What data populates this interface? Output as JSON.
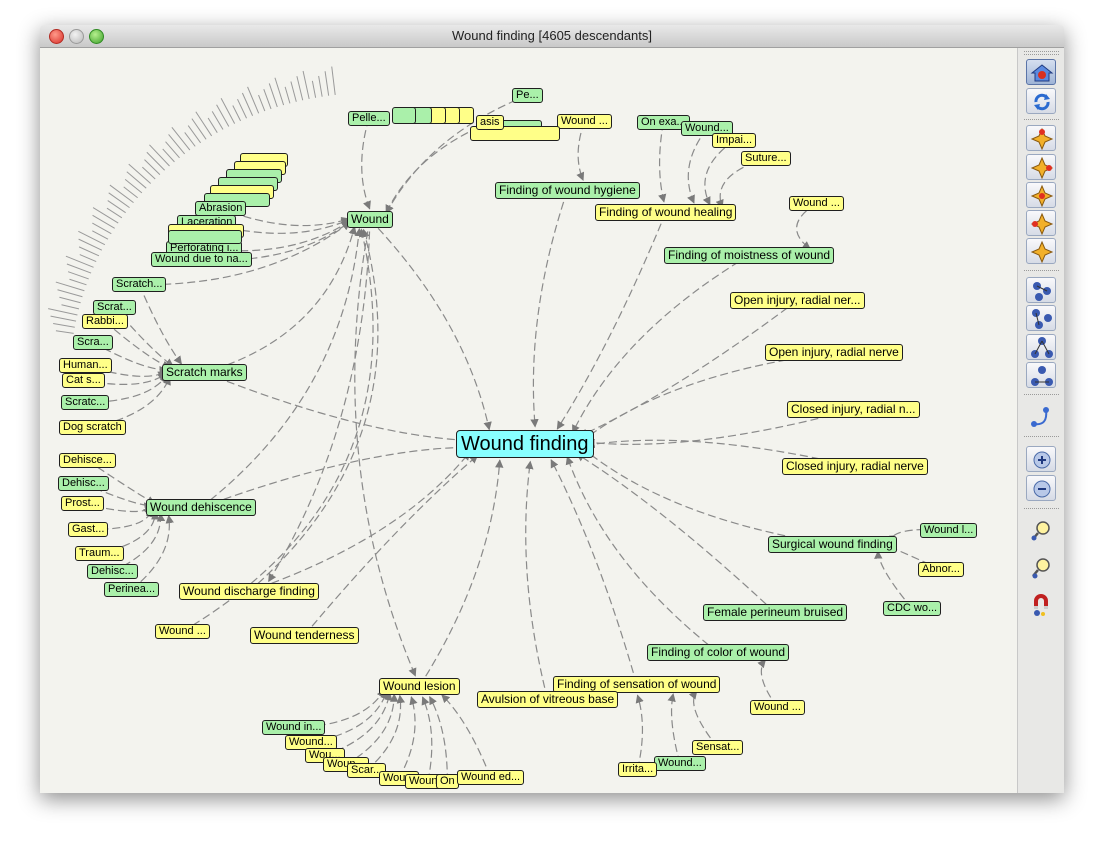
{
  "window": {
    "title": "Wound finding [4605 descendants]"
  },
  "graph": {
    "root": "Wound finding",
    "nodes": {
      "wound": "Wound",
      "wound_hygiene": "Finding of wound hygiene",
      "wound_healing": "Finding of wound healing",
      "moistness": "Finding of moistness of wound",
      "open_radial_trunc": "Open injury, radial ner...",
      "open_radial": "Open injury, radial nerve",
      "closed_radial_trunc": "Closed injury, radial n...",
      "closed_radial": "Closed injury, radial nerve",
      "surgical": "Surgical wound finding",
      "perineum": "Female perineum bruised",
      "color": "Finding of color of wound",
      "sensation": "Finding of sensation of wound",
      "avulsion": "Avulsion of vitreous base",
      "lesion": "Wound lesion",
      "tenderness": "Wound tenderness",
      "discharge": "Wound discharge finding",
      "dehiscence": "Wound dehiscence",
      "scratch": "Scratch marks",
      "wound_top": "Wound ...",
      "on_exa": "On exa...",
      "wound_g2": "Wound...",
      "impai": "Impai...",
      "suture": "Suture...",
      "wound_moist": "Wound ...",
      "pe": "Pe...",
      "pelle": "Pelle...",
      "asis": "asis",
      "abrasion": "Abrasion",
      "laceration": "Laceration",
      "perforating": "Perforating i...",
      "wound_due": "Wound due to na...",
      "scratch_s": "Scratch...",
      "scrat": "Scrat...",
      "rabbi": "Rabbi...",
      "scra": "Scra...",
      "human": "Human...",
      "cat": "Cat s...",
      "scratc": "Scratc...",
      "dog": "Dog scratch",
      "dehisce1": "Dehisce...",
      "dehisc2": "Dehisc...",
      "prost": "Prost...",
      "gast": "Gast...",
      "traum": "Traum...",
      "dehisc3": "Dehisc...",
      "perinea": "Perinea...",
      "wound_left": "Wound ...",
      "wound_l": "Wound l...",
      "abnor": "Abnor...",
      "cdc": "CDC wo...",
      "wound_color": "Wound ...",
      "sensat": "Sensat...",
      "wound_sens": "Wound...",
      "irrita": "Irrita...",
      "wound_in": "Wound in...",
      "wound_l1": "Wound...",
      "wou1": "Wou...",
      "woun1": "Woun...",
      "scar": "Scar...",
      "wou2": "Wou...",
      "woun2": "Woun...",
      "on": "On",
      "wound_ed": "Wound ed..."
    }
  },
  "toolbar": {
    "buttons": [
      "home-icon",
      "refresh-icon",
      "expand-top-icon",
      "expand-right-icon",
      "expand-center-icon",
      "expand-left-icon",
      "expand-bottom-icon",
      "layout-radial-icon",
      "layout-tree-icon",
      "layout-hierarchy-icon",
      "layout-hierarchy-alt-icon",
      "edge-style-icon",
      "zoom-in-icon",
      "zoom-out-icon",
      "search-icon",
      "find-icon",
      "magnet-icon"
    ]
  }
}
